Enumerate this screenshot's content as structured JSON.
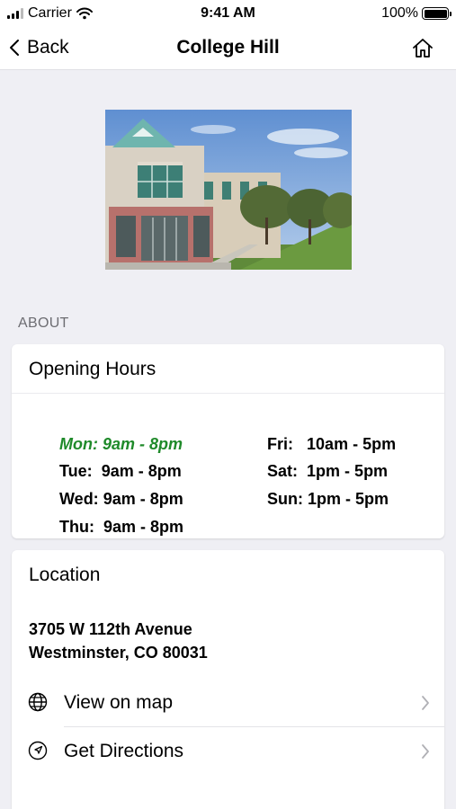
{
  "status_bar": {
    "carrier": "Carrier",
    "time": "9:41 AM",
    "battery": "100%"
  },
  "nav": {
    "back_label": "Back",
    "title": "College Hill"
  },
  "about_label": "ABOUT",
  "hours_card": {
    "title": "Opening Hours",
    "left": [
      {
        "day": "Mon:",
        "hours": "9am - 8pm",
        "today": true
      },
      {
        "day": "Tue:",
        "hours": "9am - 8pm"
      },
      {
        "day": "Wed:",
        "hours": "9am - 8pm"
      },
      {
        "day": "Thu:",
        "hours": "9am - 8pm"
      }
    ],
    "right": [
      {
        "day": "Fri:",
        "hours": "10am - 5pm"
      },
      {
        "day": "Sat:",
        "hours": "1pm - 5pm"
      },
      {
        "day": "Sun:",
        "hours": "1pm - 5pm"
      }
    ],
    "today_color": "#1f8a2a"
  },
  "location_card": {
    "title": "Location",
    "address_line1": "3705 W 112th Avenue",
    "address_line2": "Westminster, CO 80031",
    "actions": [
      {
        "label": "View on map",
        "icon": "globe-icon"
      },
      {
        "label": "Get Directions",
        "icon": "navigation-arrow-icon"
      }
    ]
  }
}
